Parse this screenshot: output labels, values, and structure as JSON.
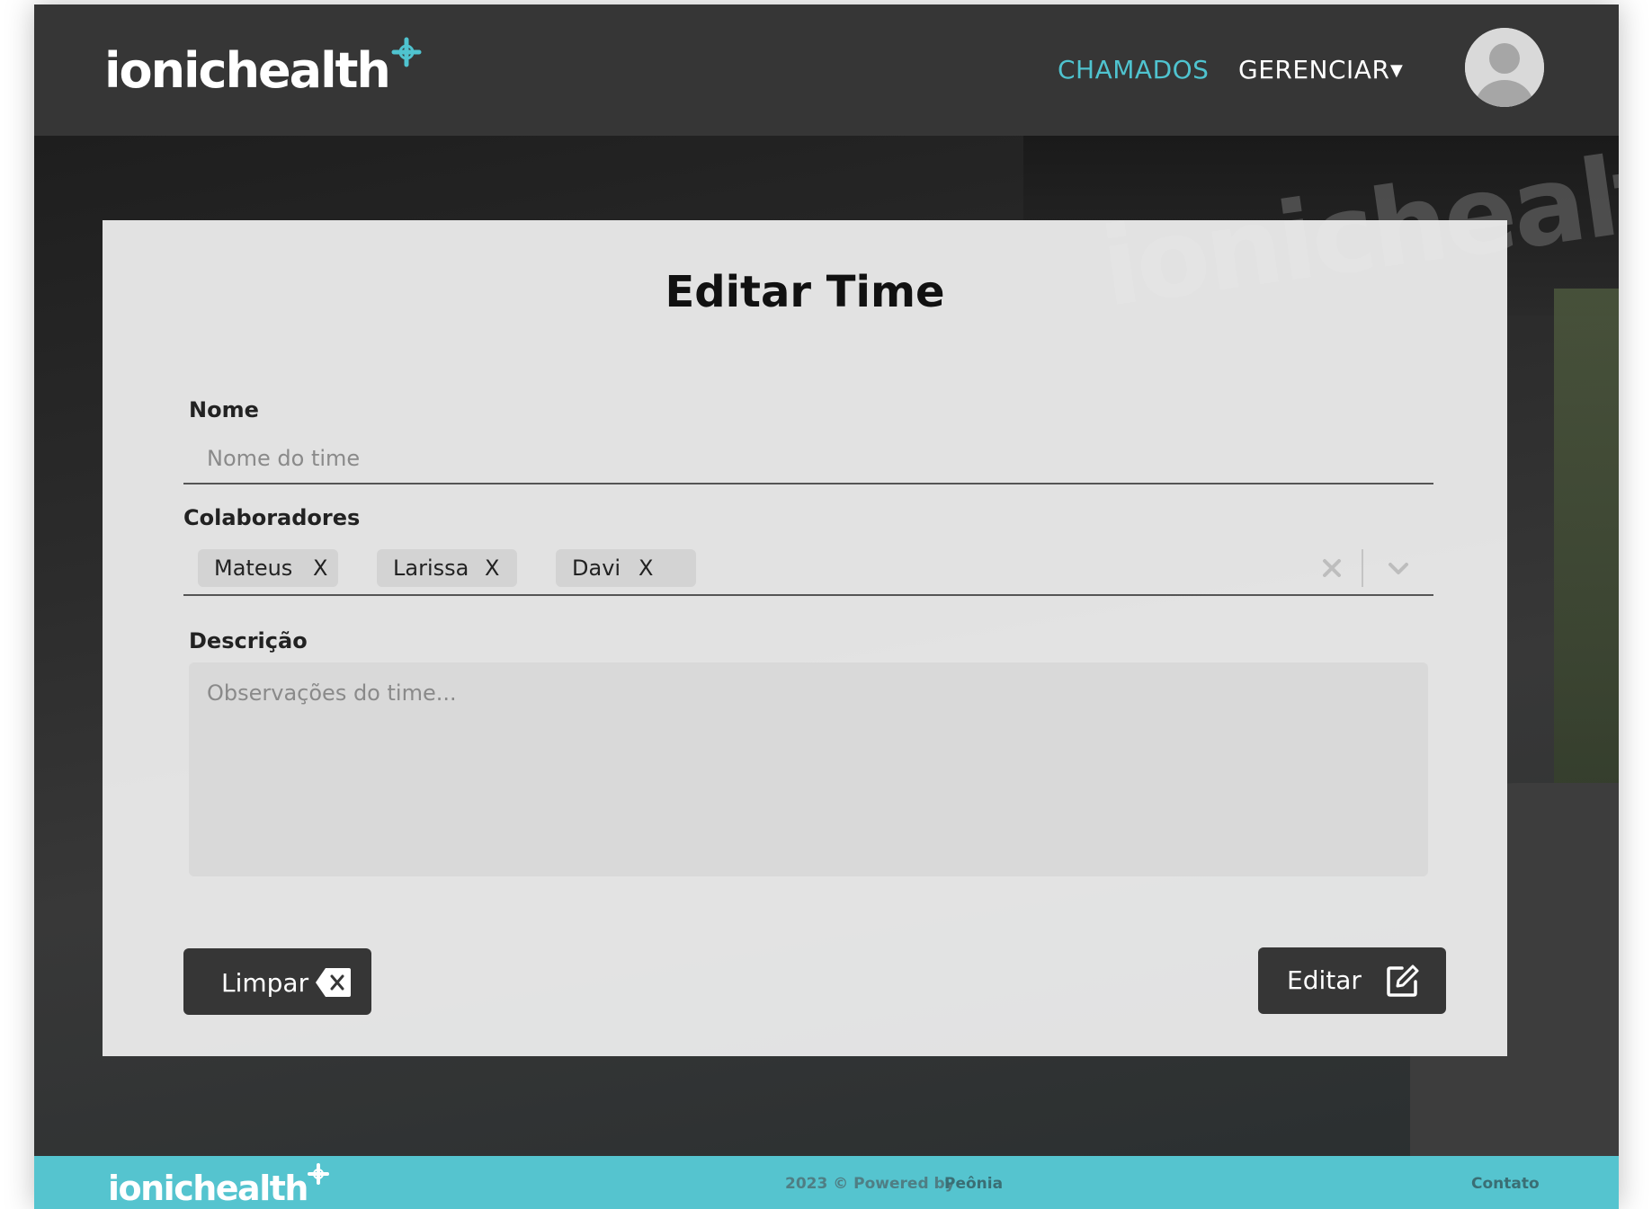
{
  "header": {
    "logo_text": "ionichealth",
    "nav": {
      "chamados_label": "CHAMADOS",
      "gerenciar_label": "GERENCIAR",
      "gerenciar_caret": "▼"
    },
    "avatar_icon": "user-avatar-icon"
  },
  "background": {
    "wall_text": "ionichealth"
  },
  "form": {
    "title": "Editar Time",
    "nome": {
      "label": "Nome",
      "value": "",
      "placeholder": "Nome do time"
    },
    "colaboradores": {
      "label": "Colaboradores",
      "selected": [
        {
          "label": "Mateus",
          "remove": "X"
        },
        {
          "label": "Larissa",
          "remove": "X"
        },
        {
          "label": "Davi",
          "remove": "X"
        }
      ],
      "clear_icon": "close-icon",
      "dropdown_icon": "chevron-down-icon"
    },
    "descricao": {
      "label": "Descrição",
      "value": "",
      "placeholder": "Observações do time..."
    },
    "buttons": {
      "limpar_label": "Limpar",
      "limpar_icon": "backspace-icon",
      "editar_label": "Editar",
      "editar_icon": "edit-icon"
    }
  },
  "footer": {
    "logo_text": "ionichealth",
    "powered_text": "2023 © Powered by",
    "brand": "Peônia",
    "contato": "Contato"
  },
  "colors": {
    "header_bg": "#363636",
    "accent": "#4fc3cf",
    "footer_bg": "#55c4cf",
    "card_bg": "#e9e9e9",
    "button_bg": "#363636"
  }
}
